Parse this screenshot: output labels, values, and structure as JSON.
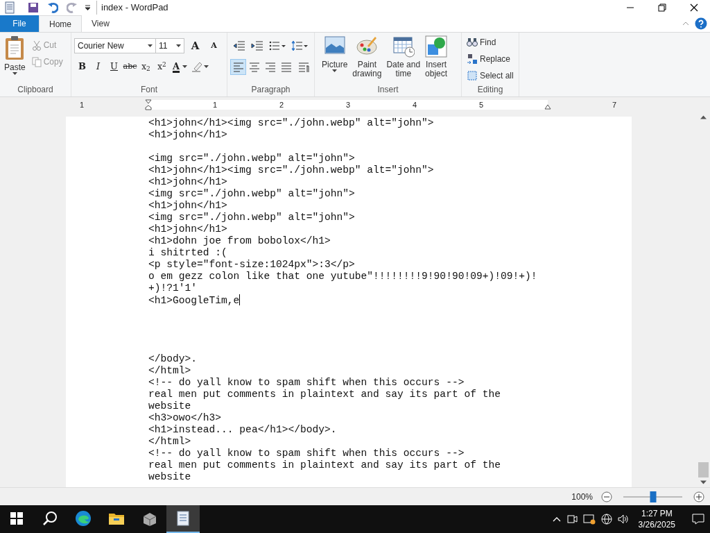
{
  "window": {
    "title": "index - WordPad"
  },
  "tabs": [
    {
      "label": "File",
      "kind": "file",
      "selected": false
    },
    {
      "label": "Home",
      "kind": "tab",
      "selected": true
    },
    {
      "label": "View",
      "kind": "tab",
      "selected": false
    }
  ],
  "clipboard": {
    "label": "Clipboard",
    "paste": "Paste",
    "cut": {
      "label": "Cut",
      "disabled": true
    },
    "copy": {
      "label": "Copy",
      "disabled": true
    }
  },
  "font": {
    "label": "Font",
    "family": "Courier New",
    "size": "11",
    "grow": "A",
    "shrink": "A",
    "formats": [
      {
        "kind": "bold",
        "label": "B"
      },
      {
        "kind": "italic",
        "label": "I"
      },
      {
        "kind": "underline",
        "label": "U"
      },
      {
        "kind": "strike",
        "label": "abc"
      },
      {
        "kind": "sub",
        "label": "x$_{2}$"
      },
      {
        "kind": "sup",
        "label": "x$^{2}$"
      }
    ],
    "color_button": "A"
  },
  "paragraph": {
    "label": "Paragraph",
    "align": [
      {
        "kind": "left",
        "selected": true
      },
      {
        "kind": "center",
        "selected": false
      },
      {
        "kind": "right",
        "selected": false
      },
      {
        "kind": "justify",
        "selected": false
      }
    ]
  },
  "insert": {
    "label": "Insert",
    "items": [
      {
        "kind": "picture",
        "lines": [
          "Picture"
        ]
      },
      {
        "kind": "paint",
        "lines": [
          "Paint",
          "drawing"
        ]
      },
      {
        "kind": "date",
        "lines": [
          "Date and",
          "time"
        ]
      },
      {
        "kind": "object",
        "lines": [
          "Insert",
          "object"
        ]
      }
    ]
  },
  "editing": {
    "label": "Editing",
    "items": [
      {
        "kind": "find",
        "label": "Find"
      },
      {
        "kind": "replace",
        "label": "Replace"
      },
      {
        "kind": "select",
        "label": "Select all"
      }
    ]
  },
  "ruler": {
    "numbers": [
      "1",
      "1",
      "2",
      "3",
      "4",
      "5",
      "7"
    ]
  },
  "document": {
    "lines": [
      {
        "kind": "text",
        "text": "<h1>john</h1><img src=\"./john.webp\" alt=\"john\">",
        "caret": false
      },
      {
        "kind": "text",
        "text": "<h1>john</h1>",
        "caret": false
      },
      {
        "kind": "blank"
      },
      {
        "kind": "text",
        "text": "<img src=\"./john.webp\" alt=\"john\">",
        "caret": false
      },
      {
        "kind": "text",
        "text": "<h1>john</h1><img src=\"./john.webp\" alt=\"john\">",
        "caret": false
      },
      {
        "kind": "text",
        "text": "<h1>john</h1>",
        "caret": false
      },
      {
        "kind": "text",
        "text": "<img src=\"./john.webp\" alt=\"john\">",
        "caret": false
      },
      {
        "kind": "text",
        "text": "<h1>john</h1>",
        "caret": false
      },
      {
        "kind": "text",
        "text": "<img src=\"./john.webp\" alt=\"john\">",
        "caret": false
      },
      {
        "kind": "text",
        "text": "<h1>john</h1>",
        "caret": false
      },
      {
        "kind": "text",
        "text": "<h1>dohn joe from bobolox</h1>",
        "caret": false
      },
      {
        "kind": "text",
        "text": "i shitrted :(",
        "caret": false
      },
      {
        "kind": "text",
        "text": "<p style=\"font-size:1024px\">:3</p>",
        "caret": false
      },
      {
        "kind": "text",
        "text": "o em gezz colon like that one yutube\"!!!!!!!!9!90!90!09+)!09!+)!",
        "caret": false
      },
      {
        "kind": "text",
        "text": "+)!?1'1'",
        "caret": false
      },
      {
        "kind": "text",
        "text": "<h1>GoogleTim,e",
        "caret": true
      },
      {
        "kind": "blank"
      },
      {
        "kind": "blank"
      },
      {
        "kind": "blank"
      },
      {
        "kind": "blank"
      },
      {
        "kind": "text",
        "text": "</body>.",
        "caret": false
      },
      {
        "kind": "text",
        "text": "</html>",
        "caret": false
      },
      {
        "kind": "text",
        "text": "<!-- do yall know to spam shift when this occurs -->",
        "caret": false
      },
      {
        "kind": "text",
        "text": "real men put comments in plaintext and say its part of the",
        "caret": false
      },
      {
        "kind": "text",
        "text": "website",
        "caret": false
      },
      {
        "kind": "text",
        "text": "<h3>owo</h3>",
        "caret": false
      },
      {
        "kind": "text",
        "text": "<h1>instead... pea</h1></body>.",
        "caret": false
      },
      {
        "kind": "text",
        "text": "</html>",
        "caret": false
      },
      {
        "kind": "text",
        "text": "<!-- do yall know to spam shift when this occurs -->",
        "caret": false
      },
      {
        "kind": "text",
        "text": "real men put comments in plaintext and say its part of the",
        "caret": false
      },
      {
        "kind": "text",
        "text": "website",
        "caret": false
      }
    ]
  },
  "status_bar": {
    "zoom": "100%",
    "zoom_slider": {
      "level": 0.5
    }
  },
  "taskbar": {
    "apps": [
      {
        "kind": "edge",
        "selected": false
      },
      {
        "kind": "explorer",
        "selected": false
      },
      {
        "kind": "app",
        "selected": false
      },
      {
        "kind": "wordpad",
        "selected": true
      }
    ],
    "time": "1:27 PM",
    "date": "3/26/2025"
  }
}
